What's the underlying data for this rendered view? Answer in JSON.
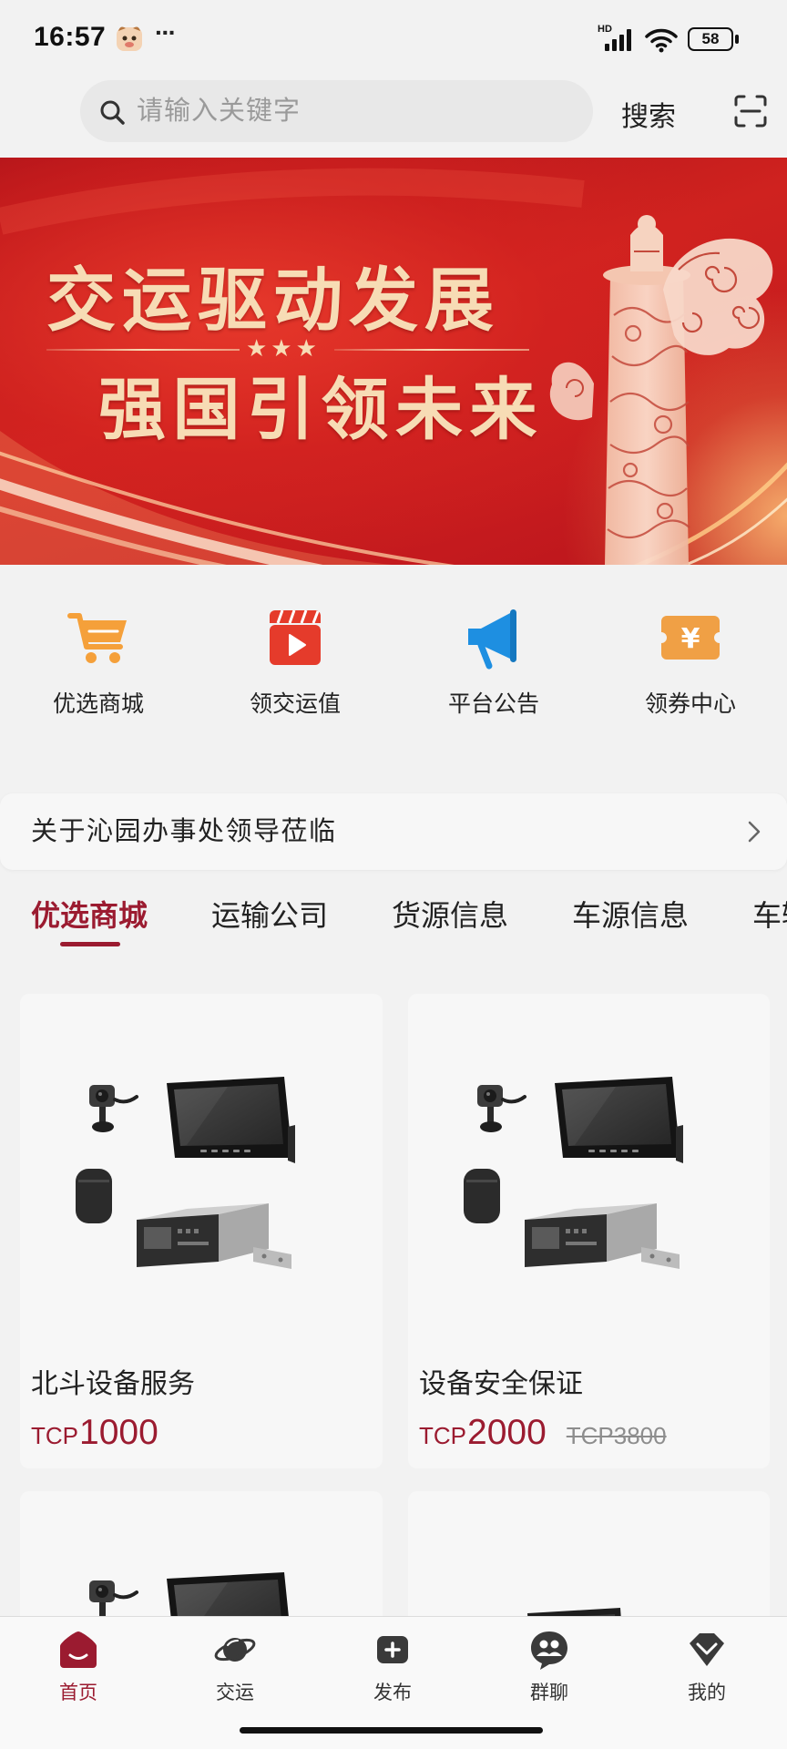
{
  "status_bar": {
    "time": "16:57",
    "more": "···",
    "network_label": "HD",
    "battery_level": "58"
  },
  "search": {
    "placeholder": "请输入关键字",
    "button_label": "搜索"
  },
  "banner": {
    "line1": "交运驱动发展",
    "line2": "强国引领未来",
    "stars": "★★★"
  },
  "quick_menu": [
    {
      "label": "优选商城",
      "icon": "cart-icon",
      "color": "#f5a03a"
    },
    {
      "label": "领交运值",
      "icon": "video-play-icon",
      "color": "#e53b2b"
    },
    {
      "label": "平台公告",
      "icon": "megaphone-icon",
      "color": "#1e8fe1"
    },
    {
      "label": "领券中心",
      "icon": "coupon-icon",
      "color": "#f0a045",
      "symbol": "¥"
    }
  ],
  "notice": {
    "text": "关于沁园办事处领导莅临"
  },
  "tabs": [
    {
      "label": "优选商城",
      "active": true
    },
    {
      "label": "运输公司",
      "active": false
    },
    {
      "label": "货源信息",
      "active": false
    },
    {
      "label": "车源信息",
      "active": false
    },
    {
      "label": "车辆",
      "active": false
    }
  ],
  "products": [
    {
      "title": "北斗设备服务",
      "currency": "TCP",
      "price": "1000"
    },
    {
      "title": "设备安全保证",
      "currency": "TCP",
      "price": "2000",
      "original_price": "TCP3800"
    }
  ],
  "bottom_nav": [
    {
      "label": "首页",
      "icon": "home-icon",
      "active": true
    },
    {
      "label": "交运",
      "icon": "planet-icon",
      "active": false
    },
    {
      "label": "发布",
      "icon": "publish-icon",
      "active": false
    },
    {
      "label": "群聊",
      "icon": "group-chat-icon",
      "active": false
    },
    {
      "label": "我的",
      "icon": "diamond-icon",
      "active": false
    }
  ],
  "colors": {
    "accent": "#9b1b30",
    "banner_red": "#c81d22",
    "banner_gold": "#f7dcb5",
    "page_background": "#f2f2f2"
  }
}
